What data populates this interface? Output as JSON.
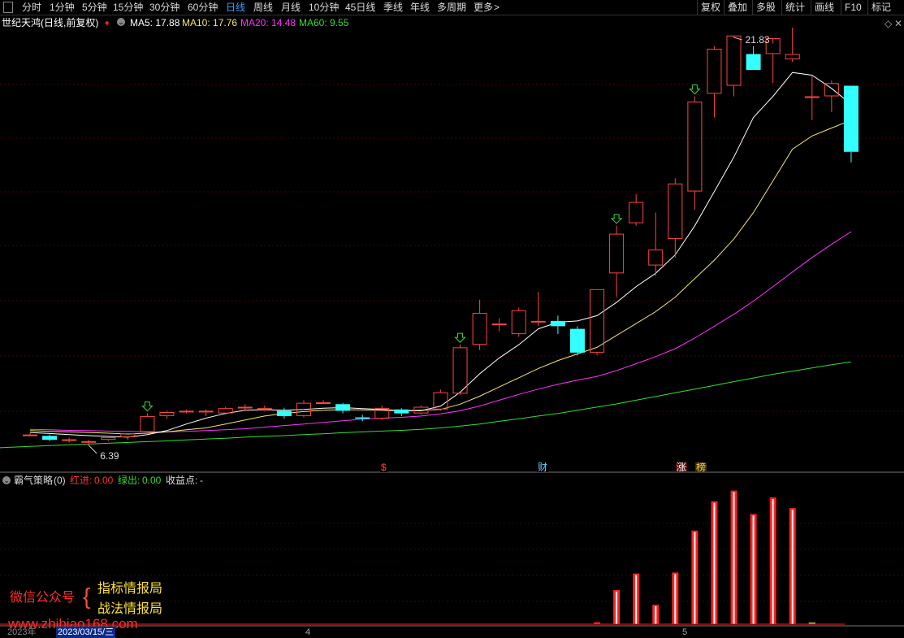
{
  "toolbar": {
    "periods": [
      "分时",
      "1分钟",
      "5分钟",
      "15分钟",
      "30分钟",
      "60分钟",
      "日线",
      "周线",
      "月线",
      "10分钟",
      "45日线",
      "季线",
      "年线",
      "多周期",
      "更多"
    ],
    "active": "日线",
    "more_arrow": ">",
    "right_tools": [
      "复权",
      "叠加",
      "多股",
      "统计",
      "画线",
      "F10",
      "标记"
    ],
    "close_symbol": "✕"
  },
  "stock": {
    "title": "世纪天鸿(日线,前复权)"
  },
  "ma": [
    {
      "label": "MA5",
      "value": "17.88",
      "color": "#ffffff"
    },
    {
      "label": "MA10",
      "value": "17.76",
      "color": "#f5e66a"
    },
    {
      "label": "MA20",
      "value": "14.48",
      "color": "#ff33ff"
    },
    {
      "label": "MA60",
      "value": "9.55",
      "color": "#33dd33"
    }
  ],
  "price_labels": {
    "high": "21.83",
    "low": "6.39"
  },
  "event_badges": [
    {
      "text": "$",
      "color": "#ff4444",
      "bg": "#000000"
    },
    {
      "text": "财",
      "color": "#66ccff",
      "bg": "#000000"
    },
    {
      "text": "涨",
      "color": "#ffffff",
      "bg": "#5a1010"
    },
    {
      "text": "榜",
      "color": "#ffcc33",
      "bg": "#3a3010"
    }
  ],
  "indicator": {
    "name": "霸气策略",
    "param": "(0)",
    "red_in_label": "红进:",
    "red_in_value": "0.00",
    "green_out_label": "绿出:",
    "green_out_value": "0.00",
    "profit_label": "收益点:",
    "profit_value": "-"
  },
  "watermark": {
    "wechat": "微信公众号",
    "brace": "{",
    "line1": "指标情报局",
    "line2": "战法情报局",
    "url": "www.zhibiao168.com"
  },
  "axis": {
    "year": "2023年",
    "cursor_date": "2023/03/15/三",
    "months": [
      "4",
      "5"
    ]
  },
  "colors": {
    "up": "#ff4444",
    "down": "#33ffff",
    "ma5": "#ffffff",
    "ma10": "#f5e66a",
    "ma20": "#ff33ff",
    "ma60": "#33dd33",
    "grid": "#4a0000"
  },
  "chart_data": {
    "type": "candlestick",
    "ohlc": [
      [
        6.8,
        6.85,
        6.75,
        6.8
      ],
      [
        6.75,
        6.8,
        6.55,
        6.6
      ],
      [
        6.6,
        6.68,
        6.5,
        6.62
      ],
      [
        6.55,
        6.6,
        6.39,
        6.55
      ],
      [
        6.6,
        6.75,
        6.55,
        6.7
      ],
      [
        6.7,
        6.85,
        6.6,
        6.85
      ],
      [
        6.9,
        7.6,
        6.85,
        7.5
      ],
      [
        7.5,
        7.7,
        7.4,
        7.65
      ],
      [
        7.7,
        7.75,
        7.6,
        7.7
      ],
      [
        7.65,
        7.75,
        7.5,
        7.7
      ],
      [
        7.6,
        7.85,
        7.55,
        7.8
      ],
      [
        7.8,
        7.95,
        7.7,
        7.85
      ],
      [
        7.8,
        7.9,
        7.7,
        7.8
      ],
      [
        7.7,
        7.8,
        7.4,
        7.5
      ],
      [
        7.5,
        8.1,
        7.45,
        8.0
      ],
      [
        8.0,
        8.1,
        7.95,
        8.02
      ],
      [
        7.95,
        8.0,
        7.6,
        7.7
      ],
      [
        7.45,
        7.55,
        7.3,
        7.4
      ],
      [
        7.4,
        7.9,
        7.35,
        7.8
      ],
      [
        7.75,
        7.8,
        7.5,
        7.6
      ],
      [
        7.6,
        7.9,
        7.55,
        7.85
      ],
      [
        7.75,
        8.5,
        7.7,
        8.4
      ],
      [
        8.35,
        10.2,
        8.3,
        10.1
      ],
      [
        10.2,
        11.9,
        10.0,
        11.4
      ],
      [
        10.95,
        11.2,
        10.7,
        11.0
      ],
      [
        10.6,
        11.6,
        10.5,
        11.5
      ],
      [
        11.1,
        12.2,
        10.9,
        11.1
      ],
      [
        11.1,
        11.3,
        10.6,
        10.9
      ],
      [
        10.8,
        10.9,
        9.8,
        9.9
      ],
      [
        9.9,
        12.3,
        9.8,
        12.3
      ],
      [
        12.9,
        14.7,
        12.0,
        14.4
      ],
      [
        14.8,
        15.9,
        14.7,
        15.6
      ],
      [
        13.2,
        15.2,
        12.8,
        13.8
      ],
      [
        14.2,
        16.5,
        13.5,
        16.3
      ],
      [
        16.0,
        19.6,
        15.3,
        19.4
      ],
      [
        19.7,
        21.5,
        18.8,
        21.4
      ],
      [
        20.0,
        21.83,
        19.6,
        21.9
      ],
      [
        21.2,
        21.5,
        20.6,
        20.6
      ],
      [
        21.2,
        21.6,
        20.1,
        21.8
      ],
      [
        21.0,
        22.2,
        20.9,
        21.2
      ],
      [
        19.6,
        20.4,
        18.7,
        19.6
      ],
      [
        19.6,
        20.2,
        19.0,
        20.1
      ],
      [
        20.0,
        20.0,
        17.1,
        17.5
      ]
    ],
    "ma5": [
      6.88,
      6.84,
      6.8,
      6.76,
      6.73,
      6.7,
      6.8,
      6.95,
      7.2,
      7.42,
      7.6,
      7.72,
      7.74,
      7.72,
      7.75,
      7.8,
      7.82,
      7.78,
      7.75,
      7.7,
      7.7,
      7.88,
      8.4,
      9.1,
      9.7,
      10.2,
      10.8,
      11.05,
      11.1,
      11.3,
      11.8,
      12.4,
      12.9,
      13.6,
      14.7,
      16.0,
      17.3,
      18.8,
      19.6,
      20.5,
      20.4,
      19.9,
      19.3
    ],
    "ma10": [
      6.95,
      6.92,
      6.9,
      6.88,
      6.85,
      6.82,
      6.85,
      6.9,
      6.98,
      7.05,
      7.2,
      7.35,
      7.5,
      7.6,
      7.67,
      7.72,
      7.74,
      7.73,
      7.72,
      7.7,
      7.72,
      7.75,
      7.95,
      8.25,
      8.6,
      8.95,
      9.3,
      9.6,
      9.85,
      10.1,
      10.55,
      11.0,
      11.45,
      12.0,
      12.7,
      13.4,
      14.2,
      15.2,
      16.4,
      17.6,
      18.1,
      18.4,
      18.7
    ],
    "ma20": [
      7.0,
      6.98,
      6.96,
      6.95,
      6.93,
      6.92,
      6.9,
      6.9,
      6.92,
      6.95,
      6.98,
      7.02,
      7.08,
      7.14,
      7.2,
      7.26,
      7.32,
      7.38,
      7.42,
      7.45,
      7.5,
      7.58,
      7.7,
      7.88,
      8.1,
      8.32,
      8.52,
      8.7,
      8.86,
      9.0,
      9.22,
      9.48,
      9.75,
      10.05,
      10.45,
      10.9,
      11.35,
      11.85,
      12.4,
      12.95,
      13.5,
      14.0,
      14.48
    ],
    "ma60": [
      6.35,
      6.38,
      6.41,
      6.44,
      6.47,
      6.5,
      6.53,
      6.56,
      6.6,
      6.63,
      6.66,
      6.7,
      6.73,
      6.76,
      6.8,
      6.83,
      6.87,
      6.9,
      6.93,
      6.96,
      7.0,
      7.05,
      7.12,
      7.2,
      7.3,
      7.4,
      7.5,
      7.6,
      7.72,
      7.84,
      7.96,
      8.1,
      8.24,
      8.38,
      8.52,
      8.66,
      8.8,
      8.94,
      9.08,
      9.2,
      9.32,
      9.44,
      9.55
    ],
    "signal_days": [
      6,
      22,
      30,
      34
    ],
    "bars": [
      0,
      0,
      0,
      0,
      0,
      0,
      0,
      0,
      0,
      0,
      0,
      0,
      0,
      0,
      0,
      0,
      0,
      0,
      0,
      0,
      0,
      0,
      0,
      0,
      0,
      0,
      0,
      0,
      0,
      0.02,
      0.35,
      0.52,
      0.2,
      0.53,
      0.96,
      1.26,
      1.37,
      1.13,
      1.3,
      1.19,
      0.02,
      0,
      0
    ],
    "bar_color": "#ff2020",
    "green_bar_day": 40
  }
}
